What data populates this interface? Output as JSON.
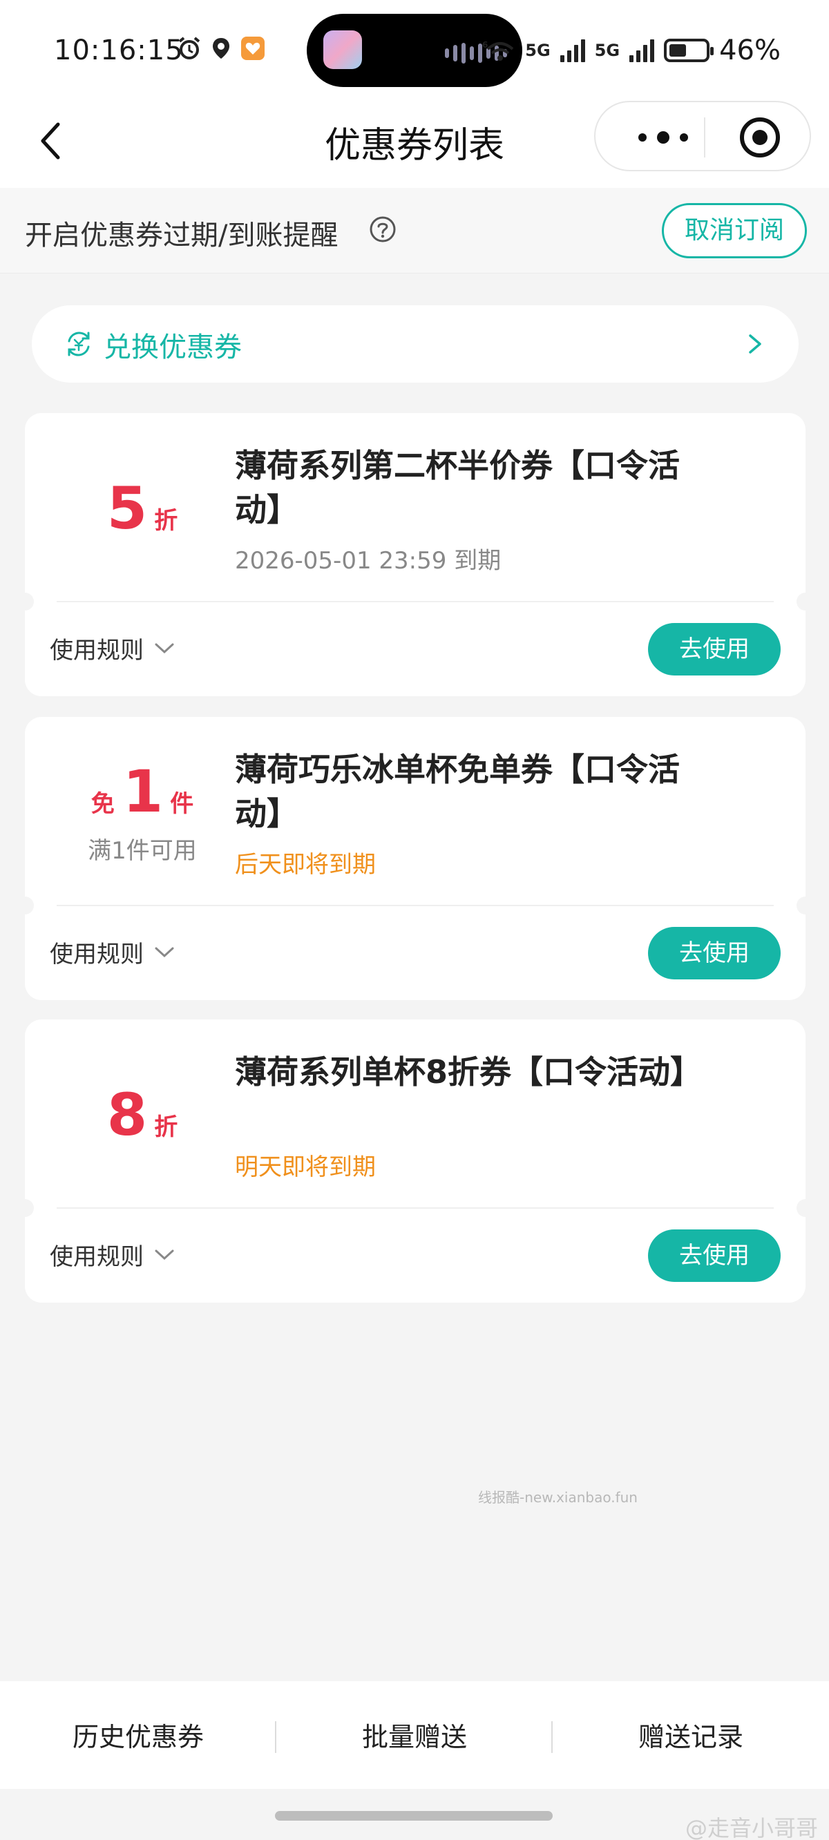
{
  "status_bar": {
    "time": "10:16:15",
    "signal_1": "5G",
    "signal_2": "5G",
    "battery_percent": "46%",
    "icons": [
      "alarm-icon",
      "location-icon",
      "app-notification-icon",
      "wifi-icon",
      "cellular-signal-icon",
      "battery-icon"
    ]
  },
  "nav": {
    "title": "优惠券列表"
  },
  "subscribe": {
    "text": "开启优惠券过期/到账提醒",
    "button": "取消订阅"
  },
  "redeem": {
    "label": "兑换优惠券"
  },
  "coupons": [
    {
      "value": "5",
      "unit": "折",
      "prefix": "",
      "condition": "",
      "title": "薄荷系列第二杯半价券【口令活动】",
      "expiry": "2026-05-01 23:59 到期",
      "rules": "使用规则",
      "action": "去使用"
    },
    {
      "value": "1",
      "unit": "件",
      "prefix": "免",
      "condition": "满1件可用",
      "title": "薄荷巧乐冰单杯免单券【口令活动】",
      "expiry": "后天即将到期",
      "rules": "使用规则",
      "action": "去使用"
    },
    {
      "value": "8",
      "unit": "折",
      "prefix": "",
      "condition": "",
      "title": "薄荷系列单杯8折券【口令活动】",
      "expiry": "明天即将到期",
      "rules": "使用规则",
      "action": "去使用"
    }
  ],
  "watermark": "线报酷-new.xianbao.fun",
  "bottom_bar": {
    "history": "历史优惠券",
    "batch_gift": "批量赠送",
    "gift_records": "赠送记录"
  },
  "weibo_watermark": "@走音小哥哥",
  "colors": {
    "accent": "#16b6a6",
    "price": "#e8344a",
    "warning": "#f0901c"
  }
}
